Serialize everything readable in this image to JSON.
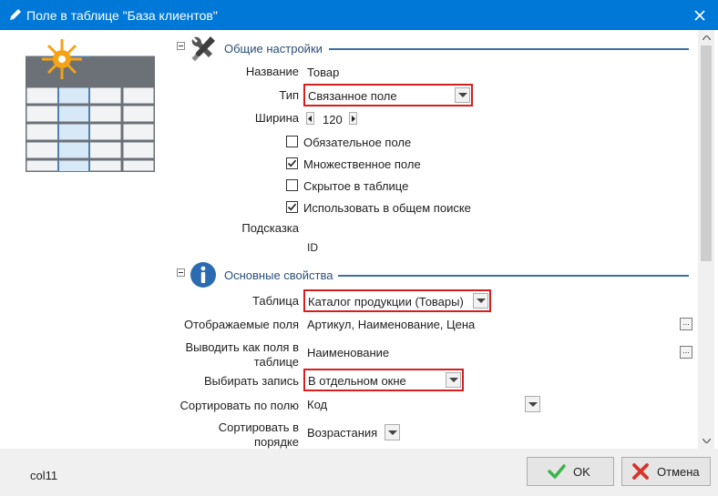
{
  "window": {
    "title": "Поле в таблице \"База клиентов\""
  },
  "sections": {
    "general": {
      "title": "Общие настройки",
      "name_label": "Название",
      "name_value": "Товар",
      "type_label": "Тип",
      "type_value": "Связанное поле",
      "width_label": "Ширина",
      "width_value": "120",
      "checkboxes": [
        {
          "label": "Обязательное поле",
          "checked": false
        },
        {
          "label": "Множественное поле",
          "checked": true
        },
        {
          "label": "Скрытое в таблице",
          "checked": false
        },
        {
          "label": "Использовать в общем поиске",
          "checked": true
        }
      ],
      "hint_label": "Подсказка",
      "id_value": "ID"
    },
    "main": {
      "title": "Основные свойства",
      "table_label": "Таблица",
      "table_value": "Каталог продукции (Товары)",
      "display_label": "Отображаемые поля",
      "display_value": "Артикул, Наименование, Цена",
      "asfields_label": "Выводить как поля в таблице",
      "asfields_value": "Наименование",
      "select_label": "Выбирать запись",
      "select_value": "В отдельном окне",
      "sortby_label": "Сортировать по полю",
      "sortby_value": "Код",
      "sortorder_label": "Сортировать в порядке",
      "sortorder_value": "Возрастания"
    }
  },
  "footer": {
    "field_code": "col11",
    "ok_label": "OK",
    "cancel_label": "Отмена"
  },
  "colors": {
    "titlebar": "#0078d7",
    "accent": "#3a6ea5",
    "highlight": "#d61e1e",
    "ok": "#3cb44b",
    "cancel": "#d9342b"
  }
}
